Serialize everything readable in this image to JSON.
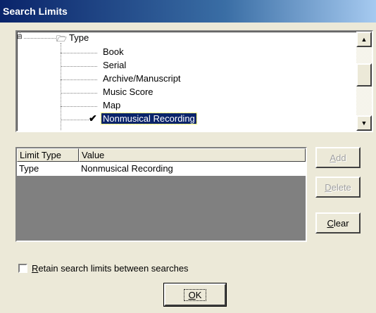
{
  "window": {
    "title": "Search Limits"
  },
  "tree": {
    "parent_label": "Type",
    "items": [
      "Book",
      "Serial",
      "Archive/Manuscript",
      "Music Score",
      "Map"
    ],
    "selected_item": "Nonmusical Recording"
  },
  "limits_table": {
    "columns": [
      "Limit Type",
      "Value"
    ],
    "rows": [
      {
        "limit_type": "Type",
        "value": "Nonmusical Recording"
      }
    ]
  },
  "buttons": {
    "add": {
      "prefix": "",
      "accel": "A",
      "suffix": "dd"
    },
    "delete": {
      "prefix": "",
      "accel": "D",
      "suffix": "elete"
    },
    "clear": {
      "prefix": "",
      "accel": "C",
      "suffix": "lear"
    },
    "ok": {
      "prefix": "",
      "accel": "O",
      "suffix": "K"
    }
  },
  "retain_checkbox": {
    "accel": "R",
    "label_rest": "etain search limits between searches",
    "checked": false
  }
}
